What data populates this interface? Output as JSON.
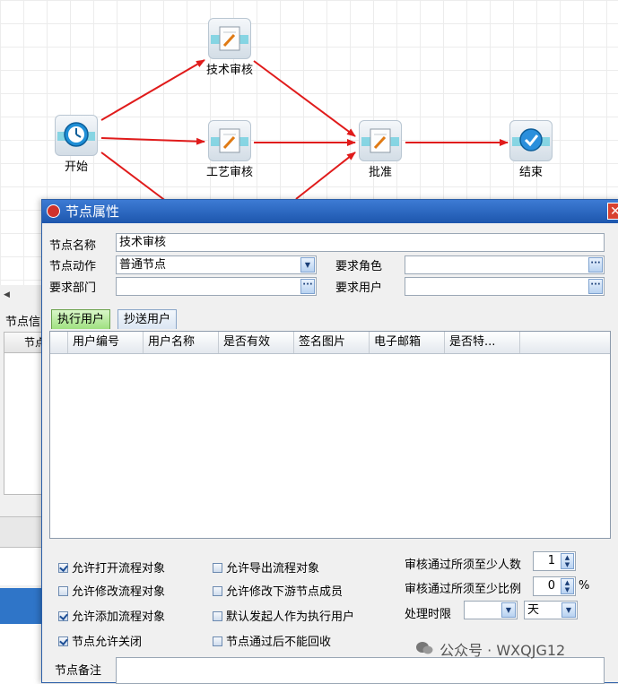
{
  "flow": {
    "nodes": {
      "start": "开始",
      "tech_review": "技术审核",
      "process_review": "工艺审核",
      "approve": "批准",
      "end": "结束"
    },
    "edge_color": "#e01b1b"
  },
  "background": {
    "tab_partial": "节点信",
    "col_partial": "节点"
  },
  "dialog": {
    "title": "节点属性",
    "close_glyph": "✕",
    "fields": {
      "node_name_label": "节点名称",
      "node_name_value": "技术审核",
      "node_action_label": "节点动作",
      "node_action_value": "普通节点",
      "required_role_label": "要求角色",
      "required_role_value": "",
      "required_dept_label": "要求部门",
      "required_dept_value": "",
      "required_user_label": "要求用户",
      "required_user_value": ""
    },
    "tabs": [
      "执行用户",
      "抄送用户"
    ],
    "grid_columns": [
      "用户编号",
      "用户名称",
      "是否有效",
      "签名图片",
      "电子邮箱",
      "是否特..."
    ],
    "options": {
      "allow_open": "允许打开流程对象",
      "allow_modify": "允许修改流程对象",
      "allow_add": "允许添加流程对象",
      "allow_close": "节点允许关闭",
      "allow_export": "允许导出流程对象",
      "allow_modify_downstream": "允许修改下游节点成员",
      "default_initiator": "默认发起人作为执行用户",
      "no_recall": "节点通过后不能回收"
    },
    "option_states": {
      "allow_open": true,
      "allow_modify": false,
      "allow_add": true,
      "allow_close": true,
      "allow_export": false,
      "allow_modify_downstream": false,
      "default_initiator": false,
      "no_recall": false
    },
    "rules": {
      "min_people_label": "审核通过所须至少人数",
      "min_people_value": "1",
      "min_ratio_label": "审核通过所须至少比例",
      "min_ratio_value": "0",
      "percent_sign": "%",
      "time_limit_label": "处理时限",
      "time_limit_value": "",
      "time_unit_value": "天"
    },
    "remark_label": "节点备注"
  },
  "watermark": "公众号 · WXQJG12"
}
